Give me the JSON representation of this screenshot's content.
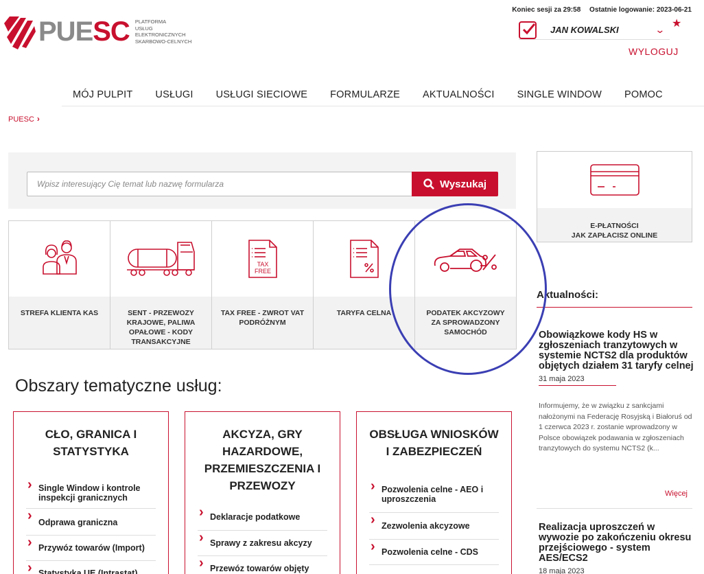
{
  "brand": {
    "logo_prefix": "PUE",
    "logo_suffix": "SC",
    "subtitle_lines": [
      "Platforma",
      "Usług",
      "Elektronicznych",
      "Skarbowo-Celnych"
    ]
  },
  "session": {
    "expiry": "Koniec sesji za 29:58",
    "last_login": "Ostatnie logowanie: 2023-06-21"
  },
  "user": {
    "name": "JAN KOWALSKI",
    "logout": "WYLOGUJ"
  },
  "nav": [
    "MÓJ PULPIT",
    "USŁUGI",
    "USŁUGI SIECIOWE",
    "FORMULARZE",
    "AKTUALNOŚCI",
    "SINGLE WINDOW",
    "POMOC"
  ],
  "breadcrumb": "PUESC",
  "search": {
    "placeholder": "Wpisz interesujący Cię temat lub nazwę formularza",
    "button": "Wyszukaj"
  },
  "tiles": [
    {
      "label": "STREFA KLIENTA KAS",
      "icon": "people-icon"
    },
    {
      "label": "SENT - PRZEWOZY KRAJOWE, PALIWA OPAŁOWE - KODY TRANSAKCYJNE",
      "icon": "tanker-truck-icon"
    },
    {
      "label": "TAX FREE - ZWROT VAT PODRÓŻNYM",
      "icon": "tax-free-document-icon"
    },
    {
      "label": "TARYFA CELNA",
      "icon": "tariff-document-icon"
    },
    {
      "label": "PODATEK AKCYZOWY ZA SPROWADZONY SAMOCHÓD",
      "icon": "car-percent-icon"
    }
  ],
  "tile_icon_text": {
    "tax": "TAX",
    "free": "FREE"
  },
  "payments": {
    "line1": "E-PŁATNOŚCI",
    "line2": "JAK ZAPŁACISZ ONLINE"
  },
  "news": {
    "title": "Aktualności:",
    "items": [
      {
        "headline": "Obowiązkowe kody HS w zgłoszeniach tranzytowych w systemie NCTS2 dla produktów objętych działem 31 taryfy celnej",
        "date": "31 maja 2023",
        "body": "Informujemy, że w związku z sankcjami nałożonymi na Federację Rosyjską i Białoruś od 1 czerwca 2023 r. zostanie wprowadzony w Polsce obowiązek podawania w zgłoszeniach tranzytowych do systemu NCTS2 (k..."
      },
      {
        "headline": "Realizacja uproszczeń w wywozie po zakończeniu okresu przejściowego - system AES/ECS2",
        "date": "18 maja 2023"
      }
    ],
    "more": "Więcej"
  },
  "section_title": "Obszary tematyczne usług:",
  "categories": [
    {
      "title": "CŁO, GRANICA I STATYSTYKA",
      "links": [
        "Single Window i kontrole inspekcji granicznych",
        "Odprawa graniczna",
        "Przywóz towarów (Import)",
        "Statystyka UE (Intrastat)"
      ]
    },
    {
      "title": "AKCYZA, GRY HAZARDOWE, PRZEMIESZCZENIA I PRZEWOZY",
      "links": [
        "Deklaracje podatkowe",
        "Sprawy z zakresu akcyzy",
        "Przewóz towarów objęty monitorowaniem (SENT)"
      ]
    },
    {
      "title": "OBSŁUGA WNIOSKÓW I ZABEZPIECZEŃ",
      "links": [
        "Pozwolenia celne - AEO i uproszczenia",
        "Zezwolenia akcyzowe",
        "Pozwolenia celne - CDS"
      ]
    }
  ],
  "colors": {
    "accent": "#c8102e",
    "annotation_circle": "#3b3fb3"
  }
}
